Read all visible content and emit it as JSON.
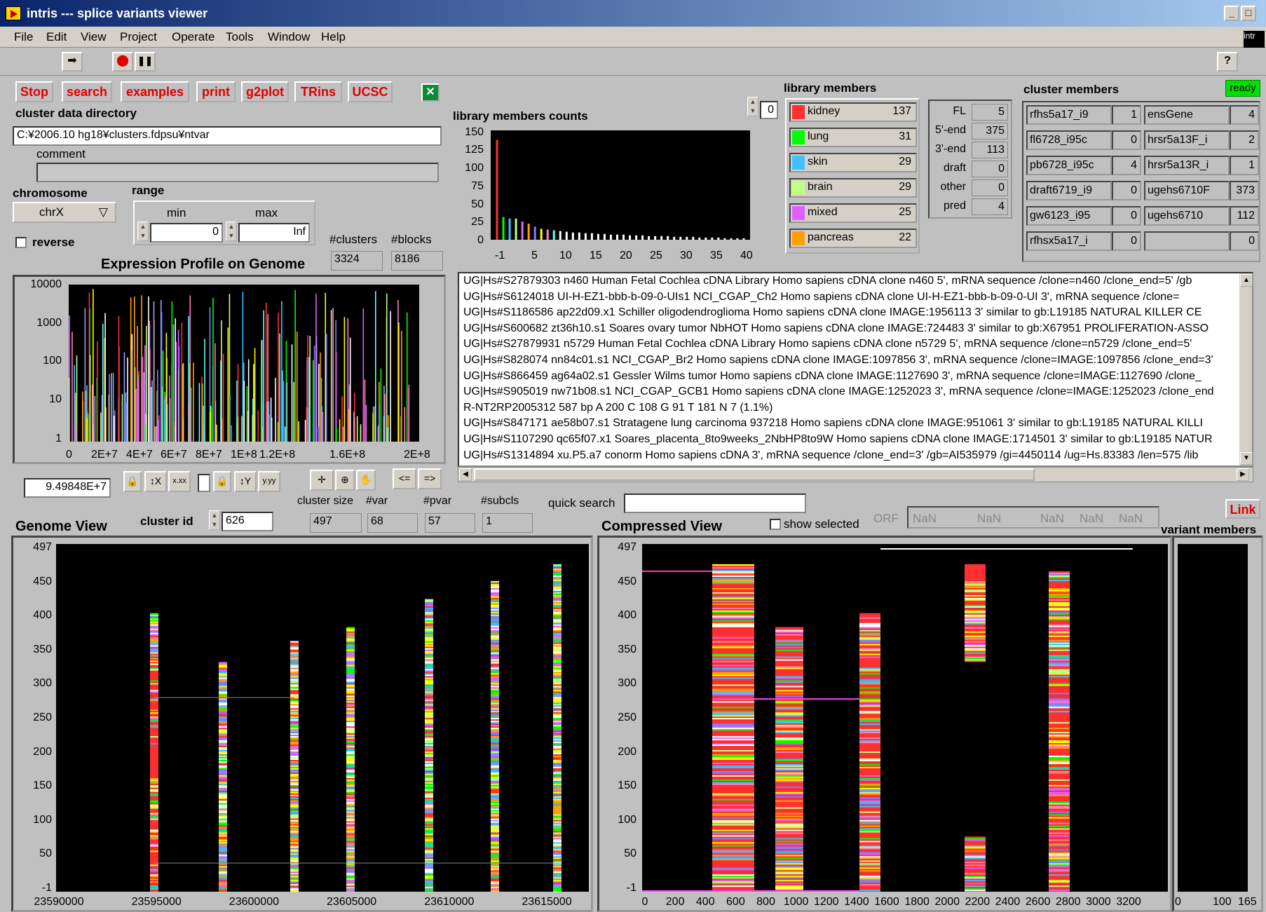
{
  "window": {
    "title": "intris --- splice variants viewer",
    "min": "_",
    "max": "□"
  },
  "menu": [
    "File",
    "Edit",
    "View",
    "Project",
    "Operate",
    "Tools",
    "Window",
    "Help"
  ],
  "toolbar": {
    "run": "➡",
    "abort": "⬤",
    "pause": "❚❚",
    "help": "?",
    "side": "intr"
  },
  "buttons": {
    "stop": "Stop",
    "search": "search",
    "examples": "examples",
    "print": "print",
    "g2plot": "g2plot",
    "trins": "TRins",
    "ucsc": "UCSC",
    "link": "Link"
  },
  "status": {
    "ready": "ready",
    "accent": "#00e000"
  },
  "cluster_dir": {
    "label": "cluster data directory",
    "value": "C:¥2006.10 hg18¥clusters.fdpsu¥ntvar",
    "comment_label": "comment",
    "comment": ""
  },
  "chromosome": {
    "label": "chromosome",
    "value": "chrX"
  },
  "range": {
    "label": "range",
    "min_label": "min",
    "max_label": "max",
    "min": "0",
    "max": "Inf"
  },
  "reverse_label": "reverse",
  "counts": {
    "clusters_label": "#clusters",
    "blocks_label": "#blocks",
    "clusters": "3324",
    "blocks": "8186"
  },
  "expression": {
    "title": "Expression Profile on Genome",
    "yticks": [
      "10000",
      "1000",
      "100",
      "10",
      "1"
    ],
    "xticks": [
      "0",
      "2E+7",
      "4E+7",
      "6E+7",
      "8E+7",
      "1E+8",
      "1.2E+8",
      "1.6E+8",
      "2E+8"
    ],
    "cursor": "9.49848E+7"
  },
  "lib_counts_chart": {
    "title": "library members counts",
    "yticks": [
      "150",
      "125",
      "100",
      "75",
      "50",
      "25",
      "0"
    ],
    "xticks": [
      "-1",
      "5",
      "10",
      "15",
      "20",
      "25",
      "30",
      "35",
      "40"
    ]
  },
  "chart_data": {
    "type": "bar",
    "title": "library members counts",
    "x": [
      0,
      1,
      2,
      3,
      4,
      5,
      6,
      7,
      8,
      9,
      10,
      11,
      12,
      13,
      14,
      15,
      16,
      17,
      18,
      19,
      20,
      21,
      22,
      23,
      24,
      25,
      26,
      27,
      28,
      29,
      30,
      31,
      32,
      33,
      34,
      35,
      36,
      37,
      38,
      39
    ],
    "values": [
      137,
      31,
      29,
      29,
      25,
      22,
      18,
      15,
      14,
      13,
      12,
      11,
      10,
      10,
      9,
      9,
      8,
      8,
      7,
      7,
      7,
      6,
      6,
      6,
      5,
      5,
      5,
      5,
      4,
      4,
      4,
      4,
      3,
      3,
      3,
      3,
      2,
      2,
      2,
      2
    ],
    "colors": [
      "#ff3030",
      "#00ff00",
      "#40c0ff",
      "#c0ff80",
      "#e060ff",
      "#ffa000",
      "#8080ff",
      "#ffff00",
      "#ff80c0",
      "#60ffff",
      "#ffffff",
      "#ffffff",
      "#ffffff",
      "#ffffff",
      "#ffffff",
      "#ffffff",
      "#ffffff",
      "#ffffff",
      "#ffffff",
      "#ffffff",
      "#ffffff",
      "#ffffff",
      "#ffffff",
      "#ffffff",
      "#ffffff",
      "#ffffff",
      "#ffffff",
      "#ffffff",
      "#ffffff",
      "#ffffff",
      "#ffffff",
      "#ffffff",
      "#ffffff",
      "#ffffff",
      "#ffffff",
      "#ffffff",
      "#ffffff",
      "#ffffff",
      "#ffffff",
      "#ffffff"
    ],
    "xlim": [
      -1,
      40
    ],
    "ylim": [
      0,
      150
    ]
  },
  "library_members": {
    "title": "library members",
    "index": "0",
    "items": [
      {
        "name": "kidney",
        "count": "137",
        "color": "#ff3030"
      },
      {
        "name": "lung",
        "count": "31",
        "color": "#00ff00"
      },
      {
        "name": "skin",
        "count": "29",
        "color": "#40c0ff"
      },
      {
        "name": "brain",
        "count": "29",
        "color": "#c0ff80"
      },
      {
        "name": "mixed",
        "count": "25",
        "color": "#e060ff"
      },
      {
        "name": "pancreas",
        "count": "22",
        "color": "#ffa000"
      }
    ]
  },
  "seq_types": [
    {
      "label": "FL",
      "value": "5"
    },
    {
      "label": "5'-end",
      "value": "375"
    },
    {
      "label": "3'-end",
      "value": "113"
    },
    {
      "label": "draft",
      "value": "0"
    },
    {
      "label": "other",
      "value": "0"
    },
    {
      "label": "pred",
      "value": "4"
    }
  ],
  "cluster_members": {
    "title": "cluster members",
    "left": [
      {
        "name": "rfhs5a17_i9",
        "v": "1"
      },
      {
        "name": "fl6728_i95c",
        "v": "0"
      },
      {
        "name": "pb6728_i95c",
        "v": "4"
      },
      {
        "name": "draft6719_i9",
        "v": "0"
      },
      {
        "name": "gw6123_i95",
        "v": "0"
      },
      {
        "name": "rfhsx5a17_i",
        "v": "0"
      }
    ],
    "right": [
      {
        "name": "ensGene",
        "v": "4"
      },
      {
        "name": "hrsr5a13F_i",
        "v": "2"
      },
      {
        "name": "hrsr5a13R_i",
        "v": "1"
      },
      {
        "name": "ugehs6710F",
        "v": "373"
      },
      {
        "name": "ugehs6710",
        "v": "112"
      },
      {
        "name": "",
        "v": "0"
      }
    ]
  },
  "sequence_list": [
    "UG|Hs#S27879303 n460 Human Fetal Cochlea cDNA Library Homo sapiens cDNA clone n460 5', mRNA sequence /clone=n460 /clone_end=5' /gb",
    "UG|Hs#S6124018 UI-H-EZ1-bbb-b-09-0-UIs1 NCI_CGAP_Ch2 Homo sapiens cDNA clone UI-H-EZ1-bbb-b-09-0-UI 3', mRNA sequence /clone=",
    "UG|Hs#S1186586 ap22d09.x1 Schiller oligodendroglioma Homo sapiens cDNA clone IMAGE:1956113 3' similar to gb:L19185 NATURAL KILLER CE",
    "UG|Hs#S600682 zt36h10.s1 Soares ovary tumor NbHOT Homo sapiens cDNA clone IMAGE:724483 3' similar to gb:X67951 PROLIFERATION-ASSO",
    "UG|Hs#S27879931 n5729 Human Fetal Cochlea cDNA Library Homo sapiens cDNA clone n5729 5', mRNA sequence /clone=n5729 /clone_end=5'",
    "UG|Hs#S828074 nn84c01.s1 NCI_CGAP_Br2 Homo sapiens cDNA clone IMAGE:1097856 3', mRNA sequence /clone=IMAGE:1097856 /clone_end=3'",
    "UG|Hs#S866459 ag64a02.s1 Gessler Wilms tumor Homo sapiens cDNA clone IMAGE:1127690 3', mRNA sequence /clone=IMAGE:1127690 /clone_",
    "UG|Hs#S905019 nw71b08.s1 NCI_CGAP_GCB1 Homo sapiens cDNA clone IMAGE:1252023 3', mRNA sequence /clone=IMAGE:1252023 /clone_end",
    "R-NT2RP2005312 587 bp   A 200   C 108   G 91   T 181   N 7 (1.1%)",
    "UG|Hs#S847171 ae58b07.s1 Stratagene lung carcinoma 937218 Homo sapiens cDNA clone IMAGE:951061 3' similar to gb:L19185 NATURAL KILLI",
    "UG|Hs#S1107290 qc65f07.x1 Soares_placenta_8to9weeks_2NbHP8to9W Homo sapiens cDNA clone IMAGE:1714501 3' similar to gb:L19185 NATUR",
    "UG|Hs#S1314894 xu.P5.a7 conorm Homo sapiens cDNA 3', mRNA sequence /clone_end=3' /gb=AI535979 /gi=4450114 /ug=Hs.83383 /len=575 /lib"
  ],
  "cluster_info": {
    "size_label": "cluster size",
    "var_label": "#var",
    "pvar_label": "#pvar",
    "subcls_label": "#subcls",
    "size": "497",
    "var": "68",
    "pvar": "57",
    "subcls": "1",
    "id_label": "cluster id",
    "id": "626"
  },
  "quick_search": {
    "label": "quick search",
    "value": ""
  },
  "show_selected": "show selected",
  "orf": {
    "label": "ORF",
    "values": [
      "NaN",
      "NaN",
      "NaN",
      "NaN",
      "NaN"
    ]
  },
  "genome_view": {
    "title": "Genome View",
    "yticks": [
      "497",
      "450",
      "400",
      "350",
      "300",
      "250",
      "200",
      "150",
      "100",
      "50",
      "-1"
    ],
    "xticks": [
      "23590000",
      "23595000",
      "23600000",
      "23605000",
      "23610000",
      "23615000"
    ]
  },
  "compressed_view": {
    "title": "Compressed View",
    "yticks": [
      "497",
      "450",
      "400",
      "350",
      "300",
      "250",
      "200",
      "150",
      "100",
      "50",
      "-1"
    ],
    "xticks": [
      "0",
      "200",
      "400",
      "600",
      "800",
      "1000",
      "1200",
      "1400",
      "1600",
      "1800",
      "2000",
      "2200",
      "2400",
      "2600",
      "2800",
      "3000",
      "3200"
    ]
  },
  "variant_members": {
    "title": "variant members",
    "xticks": [
      "0",
      "100",
      "165"
    ]
  }
}
